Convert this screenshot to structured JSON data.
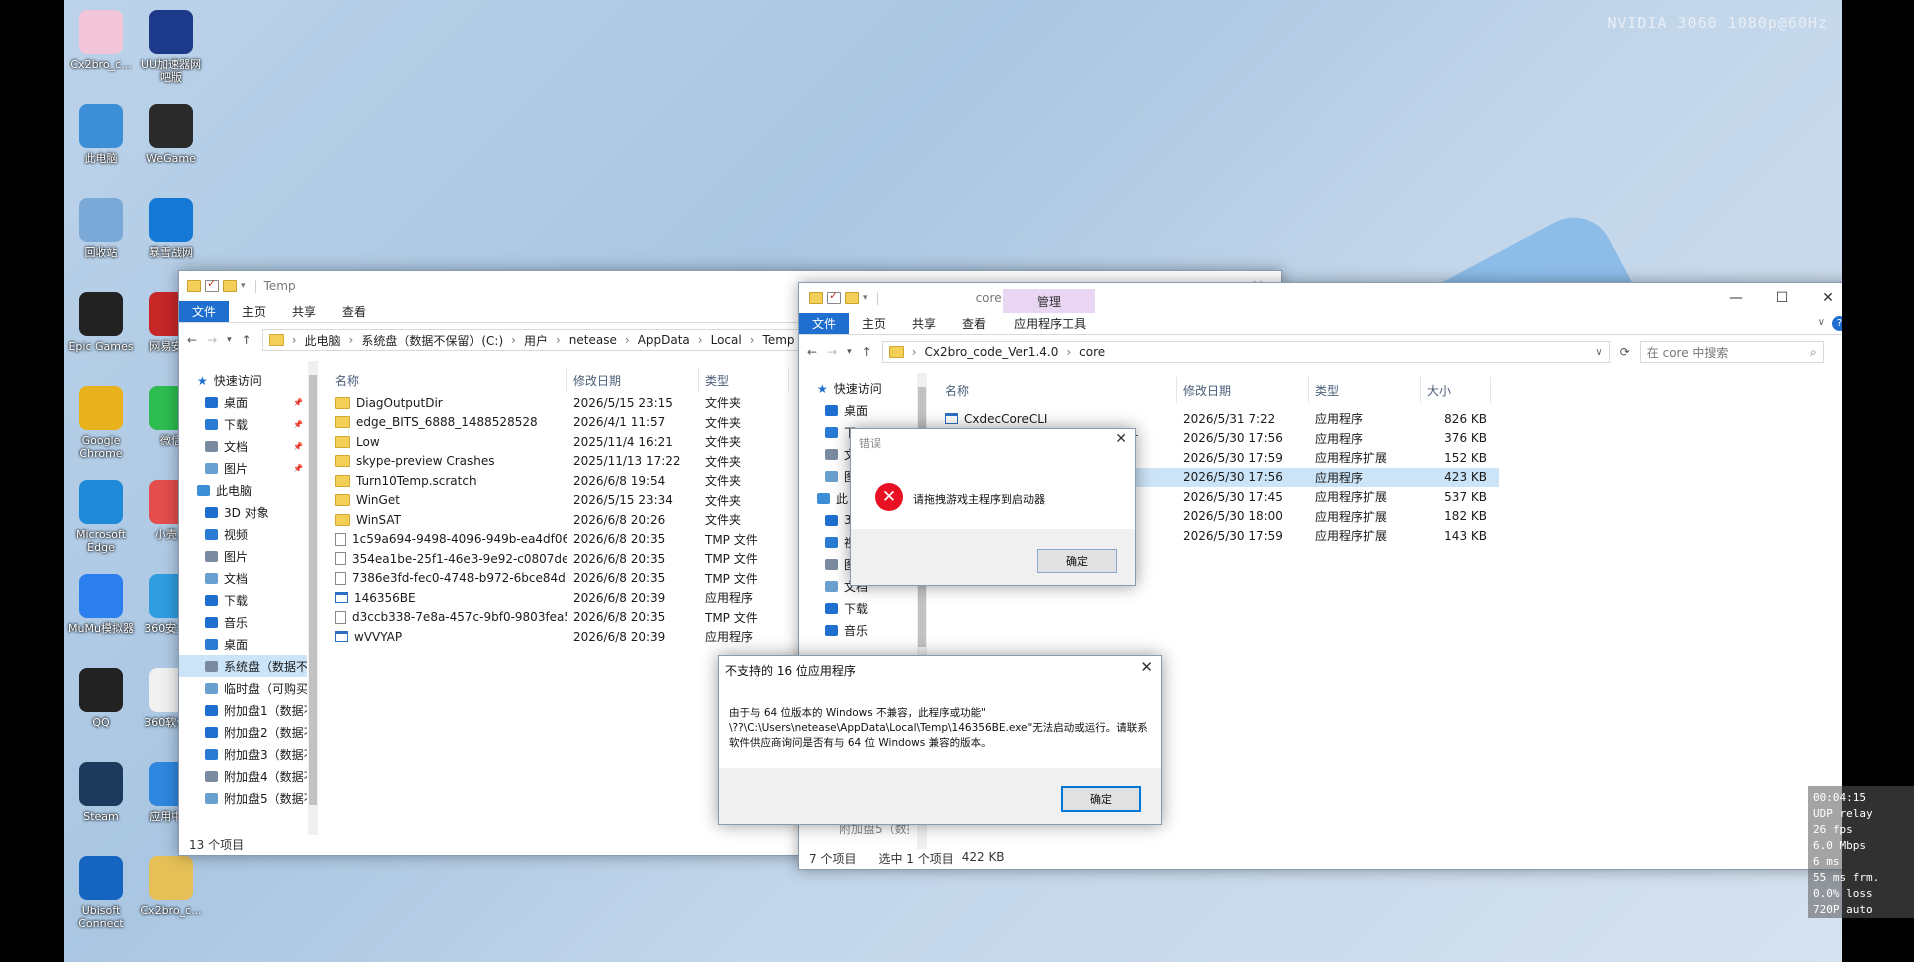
{
  "overlay": {
    "gpu_info": "NVIDIA 3060 1080p@60Hz",
    "stats": [
      "00:04:15",
      "UDP relay",
      "26 fps",
      "6.0 Mbps",
      "6 ms",
      "55 ms frm.",
      "0.0% loss",
      "720P auto"
    ]
  },
  "desktop_icons": [
    {
      "label": "Cx2bro_c...",
      "color": "#f2c6d8"
    },
    {
      "label": "UU加速器网吧版",
      "color": "#1d3a8a"
    },
    {
      "label": "此电脑",
      "color": "#3c8fd6"
    },
    {
      "label": "WeGame",
      "color": "#2a2a2a"
    },
    {
      "label": "回收站",
      "color": "#7aa9d8"
    },
    {
      "label": "暴雪战网",
      "color": "#1479d6"
    },
    {
      "label": "Epic Games",
      "color": "#222222"
    },
    {
      "label": "网易安...",
      "color": "#c62828"
    },
    {
      "label": "Google Chrome",
      "color": "#e8b21c"
    },
    {
      "label": "微信",
      "color": "#2dbd50"
    },
    {
      "label": "Microsoft Edge",
      "color": "#1f8ad8"
    },
    {
      "label": "小壳...",
      "color": "#e34d4d"
    },
    {
      "label": "MuMu模拟器",
      "color": "#2d7ff0"
    },
    {
      "label": "360安全...",
      "color": "#2f9de0"
    },
    {
      "label": "QQ",
      "color": "#222222"
    },
    {
      "label": "360软件...",
      "color": "#f0f0f0"
    },
    {
      "label": "Steam",
      "color": "#1b3a5c"
    },
    {
      "label": "应用中...",
      "color": "#2e86de"
    },
    {
      "label": "Ubisoft Connect",
      "color": "#1565c0"
    },
    {
      "label": "Cx2bro_c...",
      "color": "#e6c057"
    }
  ],
  "window_temp": {
    "title": "Temp",
    "ribbon": [
      "文件",
      "主页",
      "共享",
      "查看"
    ],
    "path": [
      "此电脑",
      "系统盘（数据不保留）(C:)",
      "用户",
      "netease",
      "AppData",
      "Local",
      "Temp"
    ],
    "nav": [
      {
        "label": "快速访问",
        "indent": 1,
        "pin": false
      },
      {
        "label": "桌面",
        "indent": 2,
        "pin": true
      },
      {
        "label": "下载",
        "indent": 2,
        "pin": true
      },
      {
        "label": "文档",
        "indent": 2,
        "pin": true
      },
      {
        "label": "图片",
        "indent": 2,
        "pin": true
      },
      {
        "label": "此电脑",
        "indent": 1,
        "pin": false
      },
      {
        "label": "3D 对象",
        "indent": 2,
        "pin": false
      },
      {
        "label": "视频",
        "indent": 2,
        "pin": false
      },
      {
        "label": "图片",
        "indent": 2,
        "pin": false
      },
      {
        "label": "文档",
        "indent": 2,
        "pin": false
      },
      {
        "label": "下载",
        "indent": 2,
        "pin": false
      },
      {
        "label": "音乐",
        "indent": 2,
        "pin": false
      },
      {
        "label": "桌面",
        "indent": 2,
        "pin": false
      },
      {
        "label": "系统盘（数据不保",
        "indent": 2,
        "pin": false,
        "selected": true
      },
      {
        "label": "临时盘（可购买",
        "indent": 2,
        "pin": false
      },
      {
        "label": "附加盘1（数据不",
        "indent": 2,
        "pin": false
      },
      {
        "label": "附加盘2（数据不",
        "indent": 2,
        "pin": false
      },
      {
        "label": "附加盘3（数据不",
        "indent": 2,
        "pin": false
      },
      {
        "label": "附加盘4（数据不",
        "indent": 2,
        "pin": false
      },
      {
        "label": "附加盘5（数据不",
        "indent": 2,
        "pin": false
      }
    ],
    "columns": [
      "名称",
      "修改日期",
      "类型"
    ],
    "rows": [
      {
        "name": "DiagOutputDir",
        "date": "2026/5/15 23:15",
        "type": "文件夹",
        "icon": "folder"
      },
      {
        "name": "edge_BITS_6888_1488528528",
        "date": "2026/4/1 11:57",
        "type": "文件夹",
        "icon": "folder"
      },
      {
        "name": "Low",
        "date": "2025/11/4 16:21",
        "type": "文件夹",
        "icon": "folder"
      },
      {
        "name": "skype-preview Crashes",
        "date": "2025/11/13 17:22",
        "type": "文件夹",
        "icon": "folder"
      },
      {
        "name": "Turn10Temp.scratch",
        "date": "2026/6/8 19:54",
        "type": "文件夹",
        "icon": "folder"
      },
      {
        "name": "WinGet",
        "date": "2026/5/15 23:34",
        "type": "文件夹",
        "icon": "folder"
      },
      {
        "name": "WinSAT",
        "date": "2026/6/8 20:26",
        "type": "文件夹",
        "icon": "folder"
      },
      {
        "name": "1c59a694-9498-4096-949b-ea4df06e...",
        "date": "2026/6/8 20:35",
        "type": "TMP 文件",
        "icon": "file"
      },
      {
        "name": "354ea1be-25f1-46e3-9e92-c0807de8...",
        "date": "2026/6/8 20:35",
        "type": "TMP 文件",
        "icon": "file"
      },
      {
        "name": "7386e3fd-fec0-4748-b972-6bce84d7...",
        "date": "2026/6/8 20:35",
        "type": "TMP 文件",
        "icon": "file"
      },
      {
        "name": "146356BE",
        "date": "2026/6/8 20:39",
        "type": "应用程序",
        "icon": "app"
      },
      {
        "name": "d3ccb338-7e8a-457c-9bf0-9803fea51...",
        "date": "2026/6/8 20:35",
        "type": "TMP 文件",
        "icon": "file"
      },
      {
        "name": "wVVYAP",
        "date": "2026/6/8 20:39",
        "type": "应用程序",
        "icon": "app"
      }
    ],
    "status": "13 个项目"
  },
  "window_core": {
    "title": "core",
    "context_tab": "管理",
    "ribbon": [
      "文件",
      "主页",
      "共享",
      "查看",
      "应用程序工具"
    ],
    "path": [
      "Cx2bro_code_Ver1.4.0",
      "core"
    ],
    "search_placeholder": "在 core 中搜索",
    "nav": [
      {
        "label": "快速访问",
        "indent": 1
      },
      {
        "label": "桌面",
        "indent": 2
      },
      {
        "label": "下",
        "indent": 2
      },
      {
        "label": "文",
        "indent": 2
      },
      {
        "label": "图",
        "indent": 2
      },
      {
        "label": "此",
        "indent": 1
      },
      {
        "label": "3",
        "indent": 2
      },
      {
        "label": "视",
        "indent": 2
      },
      {
        "label": "图",
        "indent": 2
      },
      {
        "label": "文档",
        "indent": 2
      },
      {
        "label": "下载",
        "indent": 2
      },
      {
        "label": "音乐",
        "indent": 2
      }
    ],
    "nav_bottom": "附加盘5（数据不",
    "columns": [
      "名称",
      "修改日期",
      "类型",
      "大小"
    ],
    "rows": [
      {
        "name": "CxdecCoreCLI",
        "date": "2026/5/31 7:22",
        "type": "应用程序",
        "size": "826 KB",
        "icon": "exe"
      },
      {
        "name": "CxdecDynamicHashCollector",
        "date": "2026/5/30 17:56",
        "type": "应用程序",
        "size": "376 KB",
        "icon": "exe"
      },
      {
        "name": "...dll",
        "date": "2026/5/30 17:59",
        "type": "应用程序扩展",
        "size": "152 KB",
        "icon": "dll"
      },
      {
        "name": "...oader",
        "date": "2026/5/30 17:56",
        "type": "应用程序",
        "size": "423 KB",
        "icon": "exe",
        "selected": true
      },
      {
        "name": "...ll.dll",
        "date": "2026/5/30 17:45",
        "type": "应用程序扩展",
        "size": "537 KB",
        "icon": "dll"
      },
      {
        "name": "...er.dll",
        "date": "2026/5/30 18:00",
        "type": "应用程序扩展",
        "size": "182 KB",
        "icon": "dll"
      },
      {
        "name": "...oper.dll",
        "date": "2026/5/30 17:59",
        "type": "应用程序扩展",
        "size": "143 KB",
        "icon": "dll"
      }
    ],
    "status": [
      "7 个项目",
      "选中 1 个项目",
      "422 KB"
    ]
  },
  "dialog_error": {
    "title": "错误",
    "message": "请拖拽游戏主程序到启动器",
    "ok": "确定"
  },
  "dialog_16bit": {
    "title": "不支持的 16 位应用程序",
    "message_lines": [
      "由于与 64 位版本的 Windows 不兼容，此程序或功能\"",
      "\\??\\C:\\Users\\netease\\AppData\\Local\\Temp\\146356BE.exe\"无法启动或运行。请联系",
      "软件供应商询问是否有与 64 位 Windows 兼容的版本。"
    ],
    "ok": "确定"
  },
  "colors": {
    "accent": "#1e6fcf",
    "selected": "#cce4f7",
    "error": "#e81123"
  }
}
